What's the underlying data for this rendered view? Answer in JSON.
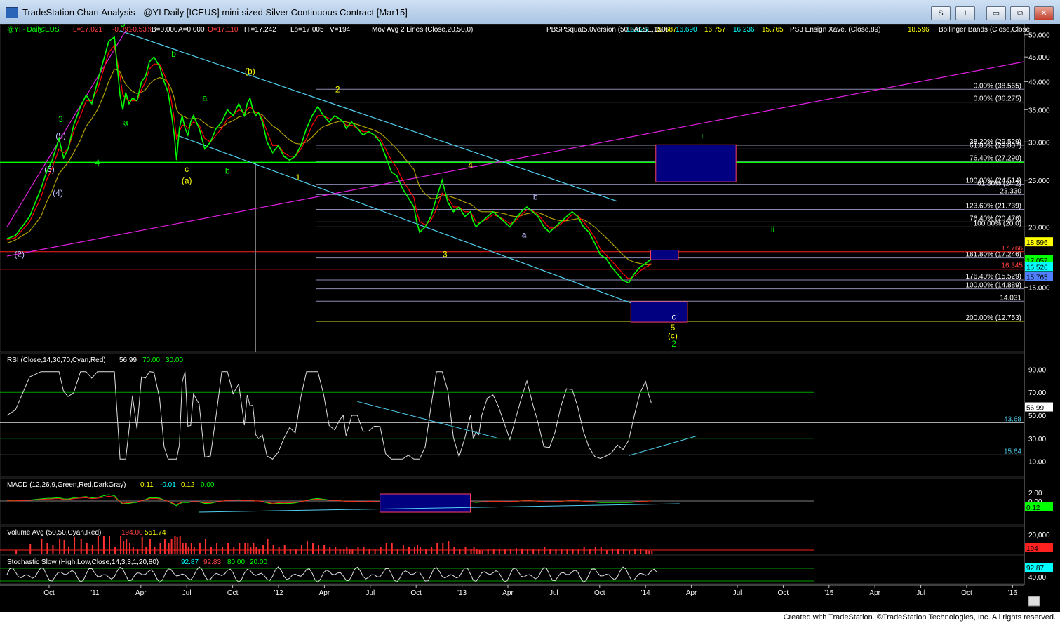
{
  "window": {
    "title": "TradeStation Chart Analysis - @YI Daily [ICEUS] mini-sized Silver Continuous Contract [Mar15]",
    "btn_s": "S",
    "btn_i": "I",
    "btn_min": "▭",
    "btn_restore": "⧉",
    "btn_close": "✕"
  },
  "footer": {
    "credit": "Created with TradeStation. ©TradeStation Technologies, Inc. All rights reserved."
  },
  "colors": {
    "bg": "#000000",
    "price": "#00ff00",
    "ma20": "#ff0000",
    "ma50": "#b0a000",
    "magenta": "#e020e0",
    "cyan": "#50d0f0",
    "fib": "#c8c8ff"
  },
  "chart_data": [
    {
      "type": "line",
      "panel": "price",
      "header": {
        "symbol": "@YI - Daily",
        "exchange": "ICEUS",
        "low": "L=17.021",
        "change": "-0.091",
        "change_pct": "-0.53%",
        "b": "B=0.000",
        "a": "A=0.000",
        "open": "O=17.110",
        "high": "Hi=17.242",
        "lo": "Lo=17.005",
        "volume": "V=194",
        "ma_label": "Mov Avg 2 Lines (Close,20,50,0)",
        "ma_v1": "16.526",
        "ma_v2": "16.687",
        "pbsp_label": "PBSPSquat5.0version (50,FALSE,150)",
        "pb_v1": "16.690",
        "pb_v2": "16.757",
        "pb_v3": "16.236",
        "pb_v4": "15.765",
        "ps3_label": "PS3 Ensign Xave. (Close,89)",
        "ps3_v": "18.596",
        "bb_label": "Bollinger Bands (Close,Close"
      },
      "y_scale": "log",
      "y_ticks": [
        "50.000",
        "45.000",
        "40.000",
        "35.000",
        "30.000",
        "25.000",
        "20.000",
        "15.000"
      ],
      "x_ticks": [
        "Oct",
        "'11",
        "Apr",
        "Jul",
        "Oct",
        "'12",
        "Apr",
        "Jul",
        "Oct",
        "'13",
        "Apr",
        "Jul",
        "Oct",
        "'14",
        "Apr",
        "Jul",
        "Oct",
        "'15",
        "Apr",
        "Jul",
        "Oct",
        "'16"
      ],
      "x_index_range": [
        0,
        1800
      ],
      "close_series": {
        "name": "Close",
        "x": [
          0,
          15,
          40,
          60,
          70,
          80,
          92,
          100,
          108,
          118,
          130,
          140,
          150,
          160,
          170,
          180,
          190,
          200,
          205,
          210,
          216,
          222,
          230,
          238,
          245,
          252,
          260,
          270,
          278,
          285,
          290,
          296,
          300,
          305,
          310,
          315,
          320,
          325,
          330,
          340,
          350,
          360,
          370,
          380,
          390,
          400,
          410,
          420,
          425,
          430,
          435,
          440,
          445,
          452,
          460,
          470,
          480,
          490,
          500,
          510,
          520,
          530,
          540,
          550,
          560,
          570,
          580,
          588,
          595,
          600,
          605,
          610,
          620,
          630,
          640,
          650,
          660,
          670,
          680,
          690,
          700,
          710,
          720,
          725,
          730,
          740,
          750,
          760,
          770,
          780,
          790,
          800,
          810,
          820,
          825,
          830,
          835,
          840,
          850,
          860,
          870,
          880,
          890,
          900,
          910,
          920,
          930,
          940,
          950,
          960,
          970,
          980,
          990,
          1000,
          1010,
          1020,
          1030,
          1040,
          1050,
          1060,
          1070,
          1080,
          1090,
          1100,
          1110,
          1120,
          1130,
          1135,
          1140,
          1145,
          1150
        ],
        "values": [
          18.9,
          19.2,
          21.0,
          24.0,
          26.0,
          27.5,
          30.5,
          27.8,
          29.0,
          32.5,
          35.5,
          37.5,
          36.0,
          40.0,
          44.0,
          48.5,
          49.5,
          37.5,
          35.0,
          38.0,
          36.0,
          37.0,
          36.5,
          40.0,
          41.0,
          44.0,
          45.0,
          43.0,
          40.0,
          38.0,
          35.0,
          31.0,
          27.5,
          32.0,
          34.0,
          32.0,
          31.0,
          33.0,
          34.0,
          32.0,
          29.0,
          30.0,
          32.0,
          33.0,
          35.0,
          34.0,
          36.0,
          34.0,
          36.0,
          37.0,
          35.0,
          34.0,
          34.5,
          33.0,
          30.0,
          28.5,
          29.5,
          28.0,
          27.5,
          28.0,
          29.5,
          32.0,
          34.0,
          35.5,
          34.0,
          33.0,
          34.0,
          33.5,
          33.0,
          32.0,
          32.5,
          33.0,
          32.0,
          31.0,
          31.5,
          31.0,
          30.0,
          28.0,
          26.0,
          25.5,
          24.0,
          23.0,
          22.0,
          20.5,
          19.5,
          20.0,
          21.0,
          23.0,
          25.0,
          22.5,
          21.5,
          22.0,
          21.0,
          21.5,
          20.5,
          20.0,
          20.3,
          20.5,
          21.0,
          21.5,
          21.0,
          20.5,
          20.0,
          20.8,
          21.5,
          22.0,
          21.5,
          21.0,
          20.0,
          19.5,
          20.0,
          20.5,
          21.0,
          21.5,
          21.0,
          20.0,
          19.5,
          18.5,
          17.5,
          17.2,
          16.5,
          16.0,
          15.5,
          15.3,
          16.0,
          16.5,
          16.8,
          17.0,
          17.1
        ]
      },
      "ma20_values": [
        18.8,
        19.0,
        20.5,
        23.0,
        25.0,
        26.5,
        29.0,
        28.5,
        29.0,
        31.5,
        34.0,
        36.5,
        36.5,
        38.5,
        42.0,
        46.0,
        47.5,
        41.0,
        37.5,
        37.0,
        36.5,
        36.5,
        36.5,
        38.5,
        40.0,
        42.5,
        43.5,
        43.5,
        41.5,
        39.5,
        37.0,
        33.5,
        30.5,
        31.5,
        32.5,
        32.5,
        32.0,
        32.5,
        33.0,
        32.5,
        30.5,
        30.0,
        31.0,
        32.0,
        33.5,
        34.0,
        35.0,
        34.5,
        35.0,
        35.5,
        35.0,
        34.5,
        34.5,
        33.5,
        31.5,
        29.5,
        29.5,
        28.5,
        28.0,
        28.0,
        29.0,
        30.5,
        32.5,
        34.0,
        34.0,
        33.5,
        33.5,
        33.5,
        33.0,
        32.5,
        32.5,
        32.5,
        32.0,
        31.5,
        31.5,
        31.0,
        30.5,
        29.0,
        27.5,
        26.5,
        25.0,
        24.0,
        23.0,
        21.5,
        20.5,
        20.2,
        20.6,
        21.8,
        23.5,
        23.0,
        22.0,
        22.0,
        21.5,
        21.5,
        21.0,
        20.5,
        20.4,
        20.5,
        20.8,
        21.2,
        21.0,
        20.7,
        20.3,
        20.6,
        21.2,
        21.7,
        21.6,
        21.2,
        20.5,
        19.9,
        19.9,
        20.3,
        20.7,
        21.2,
        21.1,
        20.5,
        19.8,
        19.0,
        18.0,
        17.5,
        17.0,
        16.5,
        16.0,
        15.6,
        15.8,
        16.2,
        16.5,
        16.6,
        16.8
      ],
      "ma50_values": [
        18.5,
        18.8,
        19.6,
        21.0,
        22.5,
        23.8,
        25.8,
        26.5,
        27.2,
        28.5,
        30.3,
        32.3,
        33.5,
        35.0,
        37.2,
        40.0,
        42.5,
        42.0,
        40.5,
        39.5,
        38.8,
        38.2,
        37.8,
        38.0,
        38.5,
        39.5,
        40.3,
        40.8,
        40.5,
        39.8,
        38.8,
        37.0,
        35.0,
        34.3,
        34.0,
        33.8,
        33.5,
        33.5,
        33.6,
        33.5,
        32.8,
        32.2,
        32.0,
        32.2,
        32.8,
        33.2,
        33.8,
        34.0,
        34.3,
        34.6,
        34.6,
        34.5,
        34.4,
        34.1,
        33.3,
        32.4,
        31.8,
        31.0,
        30.3,
        29.8,
        29.7,
        30.0,
        30.7,
        31.6,
        32.3,
        32.6,
        32.9,
        33.1,
        33.1,
        33.0,
        32.9,
        32.8,
        32.6,
        32.3,
        32.0,
        31.7,
        31.3,
        30.6,
        29.8,
        29.0,
        28.1,
        27.2,
        26.3,
        25.2,
        24.2,
        23.4,
        22.9,
        22.9,
        23.2,
        23.2,
        23.0,
        22.8,
        22.5,
        22.3,
        22.1,
        21.8,
        21.6,
        21.5,
        21.5,
        21.5,
        21.4,
        21.3,
        21.1,
        21.0,
        21.1,
        21.3,
        21.4,
        21.4,
        21.2,
        20.9,
        20.7,
        20.6,
        20.6,
        20.7,
        20.8,
        20.7,
        20.4,
        20.0,
        19.5,
        19.0,
        18.5,
        18.0,
        17.5,
        17.1,
        16.9,
        16.8,
        16.7,
        16.7,
        16.7
      ],
      "levels_right": [
        {
          "label": "0.00% (38.565)",
          "y": 38.565
        },
        {
          "label": "0.00% (36.275)",
          "y": 36.275
        },
        {
          "label": "38.20% (29.529)",
          "y": 29.529
        },
        {
          "label": "61.80% (29.007)",
          "y": 29.007
        },
        {
          "label": "76.40% (27.290)",
          "y": 27.29
        },
        {
          "label": "100.00% (24.514)",
          "y": 24.514
        },
        {
          "label": "61.80% (24.2)",
          "y": 24.2
        },
        {
          "label": "23.330",
          "y": 23.33
        },
        {
          "label": "123.60% (21.739)",
          "y": 21.739
        },
        {
          "label": "76.40% (20.476)",
          "y": 20.476
        },
        {
          "label": "100.00% (20.0)",
          "y": 20.0
        },
        {
          "label": "181.80% (17.246)",
          "y": 17.246
        },
        {
          "label": "176.40% (15.529)",
          "y": 15.529
        },
        {
          "label": "100.00% (14.889)",
          "y": 14.889
        },
        {
          "label": "14.031",
          "y": 14.031
        },
        {
          "label": "200.00% (12.753)",
          "y": 12.753
        }
      ],
      "red_levels": [
        {
          "label": "17.766",
          "y": 17.766
        },
        {
          "label": "16.345",
          "y": 16.345
        }
      ],
      "right_badges": [
        {
          "label": "18.596",
          "y": 18.596,
          "bg": "#ffff00",
          "fg": "#000000"
        },
        {
          "label": "17.057",
          "y": 17.057,
          "bg": "#00ff00",
          "fg": "#000000"
        },
        {
          "label": "16.526",
          "y": 16.526,
          "bg": "#00ffff",
          "fg": "#000000"
        },
        {
          "label": "15.765",
          "y": 15.765,
          "bg": "#5080ff",
          "fg": "#000000"
        }
      ],
      "wave_labels": [
        {
          "text": "5",
          "x": 205,
          "y": 52.0,
          "color": "#00ff00"
        },
        {
          "text": "3",
          "x": 95,
          "y": 33.0,
          "color": "#00ff00"
        },
        {
          "text": "(5)",
          "x": 95,
          "y": 30.5,
          "color": "#c0c0ff"
        },
        {
          "text": "(3)",
          "x": 75,
          "y": 26.0,
          "color": "#c0c0ff"
        },
        {
          "text": "(4)",
          "x": 90,
          "y": 23.2,
          "color": "#c0c0ff"
        },
        {
          "text": "4",
          "x": 160,
          "y": 26.8,
          "color": "#00ff00"
        },
        {
          "text": "(2)",
          "x": 22,
          "y": 17.3,
          "color": "#c0c0ff"
        },
        {
          "text": "a",
          "x": 210,
          "y": 32.5,
          "color": "#00ff00"
        },
        {
          "text": "b",
          "x": 295,
          "y": 45.0,
          "color": "#00ff00"
        },
        {
          "text": "c",
          "x": 318,
          "y": 26.0,
          "color": "#ffff00"
        },
        {
          "text": "(a)",
          "x": 318,
          "y": 24.6,
          "color": "#ffff00"
        },
        {
          "text": "a",
          "x": 350,
          "y": 36.5,
          "color": "#00ff00"
        },
        {
          "text": "b",
          "x": 390,
          "y": 25.8,
          "color": "#00ff00"
        },
        {
          "text": "(b)",
          "x": 430,
          "y": 41.5,
          "color": "#ffff00"
        },
        {
          "text": "1",
          "x": 515,
          "y": 25.0,
          "color": "#ffff00"
        },
        {
          "text": "2",
          "x": 585,
          "y": 38.0,
          "color": "#ffff00"
        },
        {
          "text": "3",
          "x": 775,
          "y": 17.3,
          "color": "#ffff00"
        },
        {
          "text": "4",
          "x": 820,
          "y": 26.5,
          "color": "#ffff00"
        },
        {
          "text": "b",
          "x": 935,
          "y": 22.8,
          "color": "#c0c0ff"
        },
        {
          "text": "a",
          "x": 915,
          "y": 19.0,
          "color": "#c0c0ff"
        },
        {
          "text": "i",
          "x": 1230,
          "y": 30.5,
          "color": "#00ff00"
        },
        {
          "text": "ii",
          "x": 1355,
          "y": 19.5,
          "color": "#00ff00"
        },
        {
          "text": "c",
          "x": 1180,
          "y": 12.85,
          "color": "#ffffff"
        },
        {
          "text": "5",
          "x": 1178,
          "y": 12.2,
          "color": "#ffff00"
        },
        {
          "text": "(c)",
          "x": 1178,
          "y": 11.75,
          "color": "#ffff00"
        },
        {
          "text": "2",
          "x": 1180,
          "y": 11.3,
          "color": "#00ff00"
        }
      ]
    },
    {
      "type": "line",
      "panel": "rsi",
      "header": {
        "label": "RSI (Close,14,30,70,Cyan,Red)",
        "v1": "56.99",
        "v2": "70.00",
        "v3": "30.00"
      },
      "y_ticks": [
        "90.00",
        "70.00",
        "50.00",
        "30.00",
        "10.00"
      ],
      "levels": [
        {
          "label": "43.68",
          "y": 43.68
        },
        {
          "label": "15.64",
          "y": 15.64
        }
      ],
      "current": "56.99",
      "ylim": [
        0,
        100
      ]
    },
    {
      "type": "line",
      "panel": "macd",
      "header": {
        "label": "MACD (12,26,9,Green,Red,DarkGray)",
        "v1": "0.11",
        "v2": "-0.01",
        "v3": "0.12",
        "v4": "0.00"
      },
      "y_ticks": [
        "2.00",
        "0.00"
      ],
      "current": "0.12"
    },
    {
      "type": "bar",
      "panel": "volume",
      "header": {
        "label": "Volume Avg (50,50,Cyan,Red)",
        "v1": "194.00",
        "v2": "551.74"
      },
      "y_ticks": [
        "20,000",
        "8,000"
      ],
      "current": "194"
    },
    {
      "type": "line",
      "panel": "stochastic",
      "header": {
        "label": "Stochastic Slow (High,Low,Close,14,3,3,1,20,80)",
        "v1": "92.87",
        "v2": "92.83",
        "v3": "80.00",
        "v4": "20.00"
      },
      "y_ticks": [
        "40.00"
      ],
      "current": "92.87"
    }
  ]
}
